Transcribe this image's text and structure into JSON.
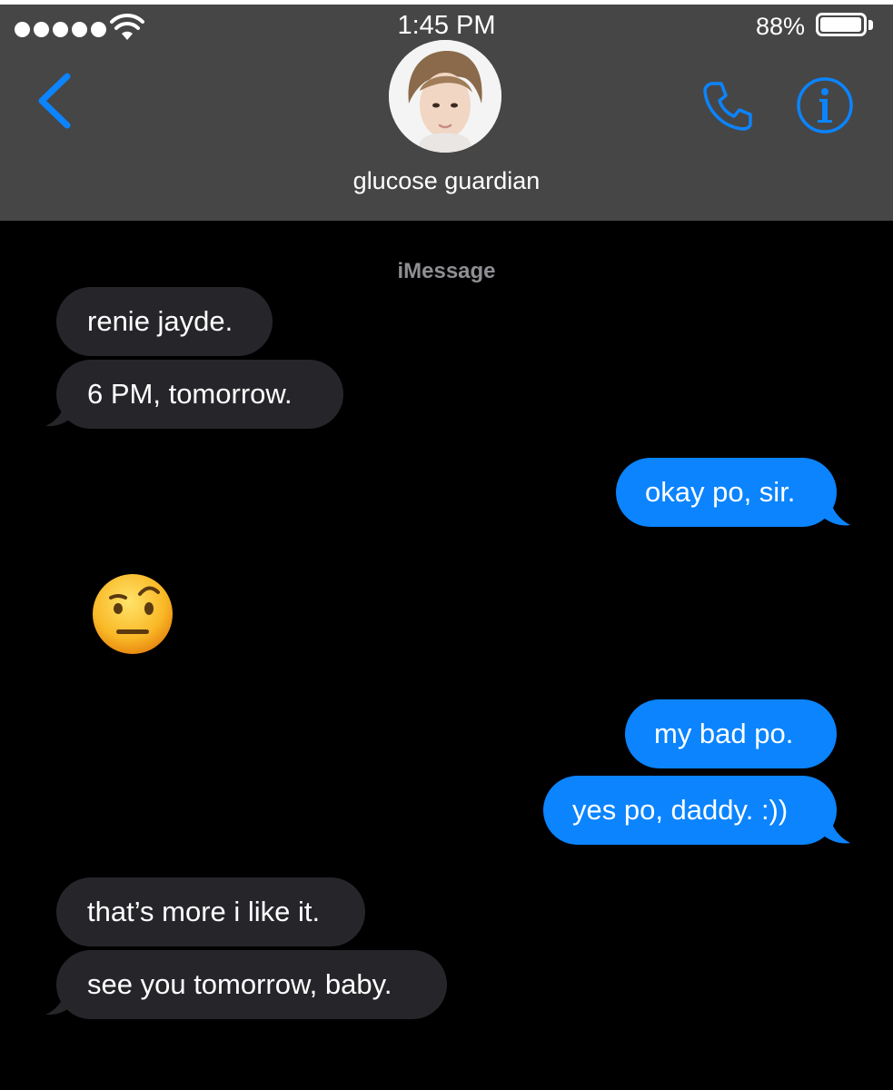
{
  "status_bar": {
    "time": "1:45 PM",
    "battery_percent": "88%",
    "battery_level": 0.88,
    "signal_bars": 5,
    "icons": [
      "signal-dots",
      "wifi-icon",
      "battery-icon"
    ]
  },
  "header": {
    "contact_name": "glucose guardian",
    "icons": [
      "back-chevron-icon",
      "avatar",
      "phone-icon",
      "info-icon"
    ],
    "accent_color": "#0b84fe"
  },
  "thread": {
    "service_label": "iMessage",
    "messages": [
      {
        "from": "them",
        "text": "renie jayde."
      },
      {
        "from": "them",
        "text": "6 PM, tomorrow."
      },
      {
        "from": "me",
        "text": "okay po, sir."
      },
      {
        "from": "them",
        "emoji": "face-with-raised-eyebrow"
      },
      {
        "from": "me",
        "text": "my bad po."
      },
      {
        "from": "me",
        "text": "yes po, daddy. :))"
      },
      {
        "from": "them",
        "text": "that’s more i like it."
      },
      {
        "from": "them",
        "text": "see you tomorrow, baby."
      }
    ]
  },
  "colors": {
    "header_bg": "#464646",
    "incoming_bubble": "#26262a",
    "outgoing_bubble": "#0b84fe",
    "background": "#000000"
  }
}
